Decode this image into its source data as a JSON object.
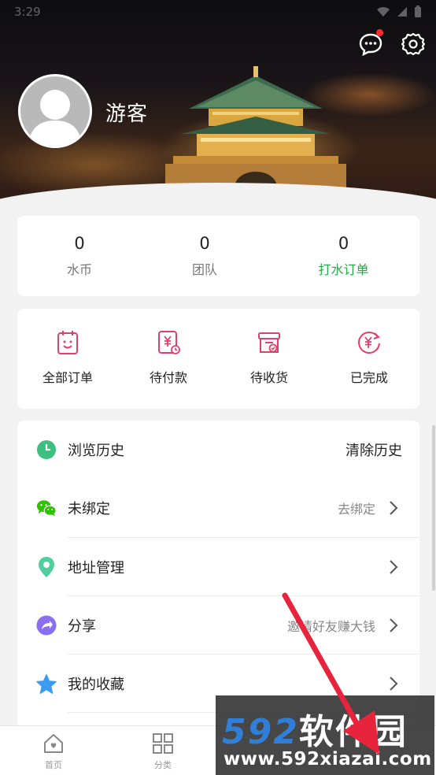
{
  "status_bar": {
    "time": "3:29"
  },
  "profile": {
    "username": "游客"
  },
  "stats": [
    {
      "value": "0",
      "label": "水币"
    },
    {
      "value": "0",
      "label": "团队"
    },
    {
      "value": "0",
      "label": "打水订单"
    }
  ],
  "orders": [
    {
      "label": "全部订单",
      "icon": "clipboard-icon"
    },
    {
      "label": "待付款",
      "icon": "payment-icon"
    },
    {
      "label": "待收货",
      "icon": "package-icon"
    },
    {
      "label": "已完成",
      "icon": "completed-icon"
    }
  ],
  "menu": {
    "history": {
      "label": "浏览历史",
      "action": "清除历史"
    },
    "wechat": {
      "label": "未绑定",
      "action": "去绑定"
    },
    "address": {
      "label": "地址管理"
    },
    "share": {
      "label": "分享",
      "hint": "邀请好友赚大钱"
    },
    "favorites": {
      "label": "我的收藏"
    }
  },
  "tabs": [
    {
      "label": "首页",
      "icon": "home-icon"
    },
    {
      "label": "分类",
      "icon": "grid-icon"
    }
  ],
  "watermark": {
    "num": "592",
    "cn": "软件园",
    "url": "www.592xiazai.com"
  },
  "colors": {
    "accent_green": "#2aa84a",
    "order_icon": "#e0406a",
    "clock": "#3fbf7f",
    "wechat": "#2dc100",
    "location": "#4fcf9e",
    "share": "#8a6ff0",
    "star": "#3a9cf0",
    "watermark_blue": "#2f7fd8",
    "arrow_red": "#e8243c"
  }
}
